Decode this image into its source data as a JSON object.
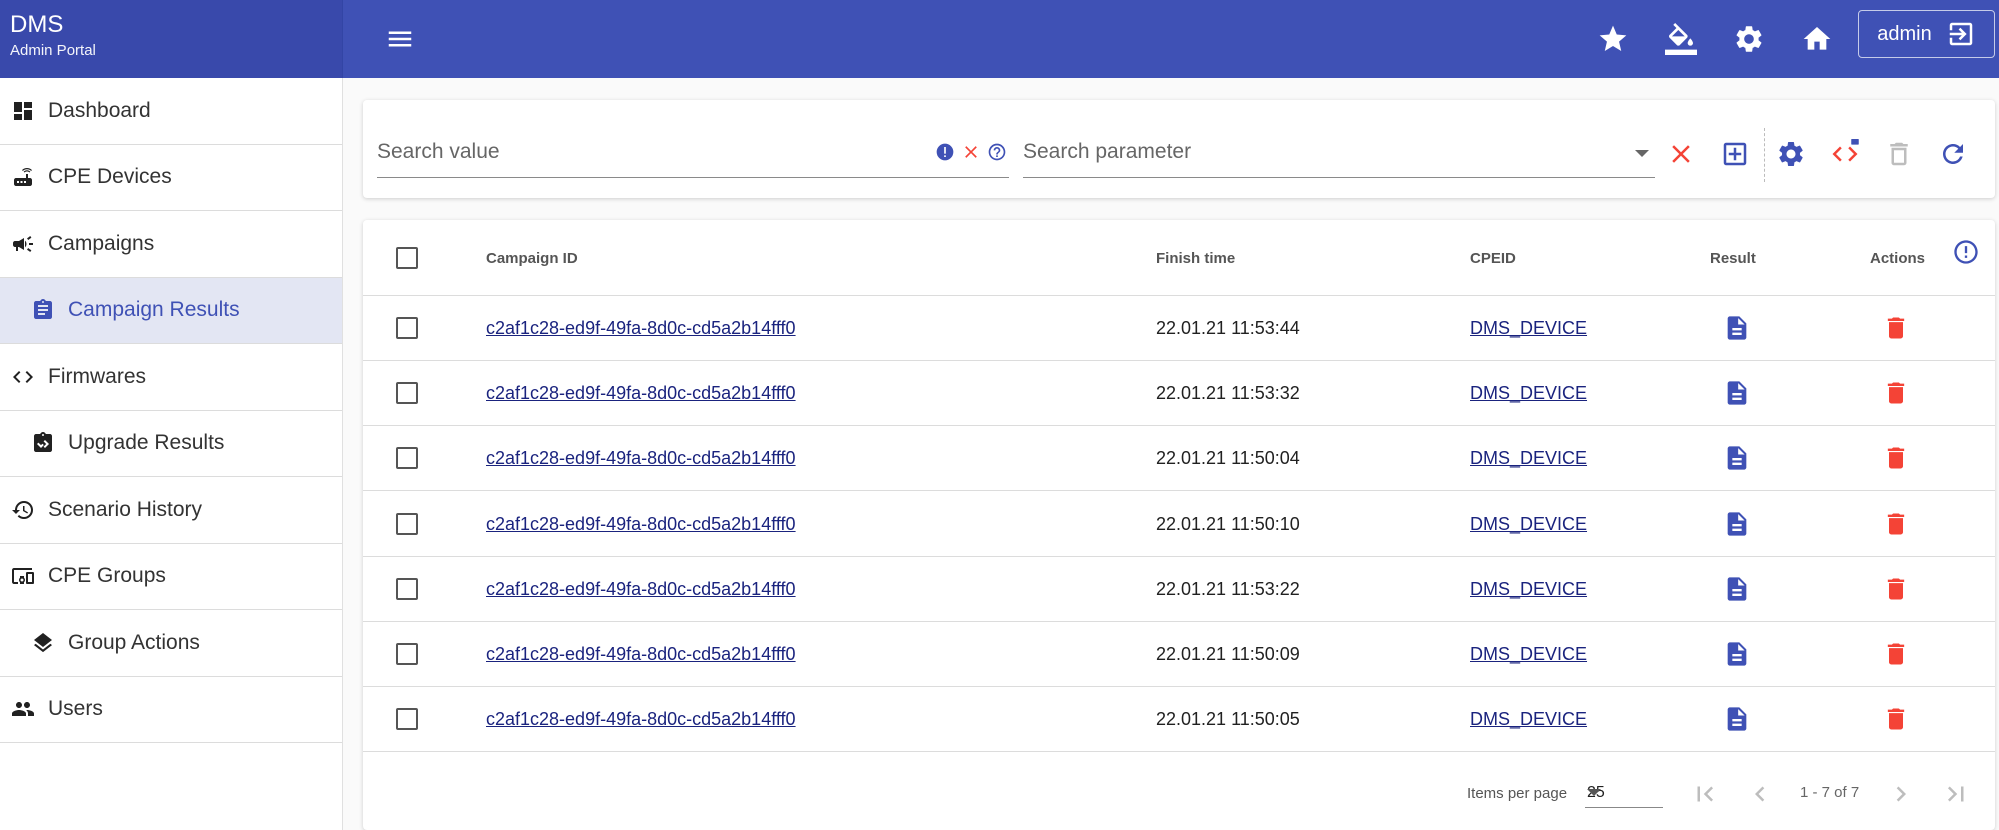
{
  "app": {
    "title": "DMS",
    "subtitle": "Admin Portal"
  },
  "header": {
    "user_label": "admin",
    "icons": [
      "star-icon",
      "format-color-fill-icon",
      "gear-icon",
      "home-icon",
      "exit-to-app-icon",
      "menu-icon"
    ]
  },
  "sidebar": {
    "items": [
      {
        "label": "Dashboard",
        "icon": "dashboard-icon"
      },
      {
        "label": "CPE Devices",
        "icon": "router-icon"
      },
      {
        "label": "Campaigns",
        "icon": "campaign-icon"
      },
      {
        "label": "Campaign Results",
        "icon": "assignment-icon"
      },
      {
        "label": "Firmwares",
        "icon": "code-icon"
      },
      {
        "label": "Upgrade Results",
        "icon": "upgrade-icon"
      },
      {
        "label": "Scenario History",
        "icon": "history-icon"
      },
      {
        "label": "CPE Groups",
        "icon": "devices-icon"
      },
      {
        "label": "Group Actions",
        "icon": "layers-icon"
      },
      {
        "label": "Users",
        "icon": "people-icon"
      }
    ],
    "active": "Campaign Results"
  },
  "search": {
    "value_placeholder": "Search value",
    "value": "",
    "parameter_placeholder": "Search parameter",
    "parameter": ""
  },
  "table": {
    "columns": {
      "campaign_id": "Campaign ID",
      "finish_time": "Finish time",
      "cpeid": "CPEID",
      "result": "Result",
      "actions": "Actions"
    },
    "rows": [
      {
        "campaign_id": "c2af1c28-ed9f-49fa-8d0c-cd5a2b14fff0",
        "finish_time": "22.01.21 11:53:44",
        "cpeid": "DMS_DEVICE"
      },
      {
        "campaign_id": "c2af1c28-ed9f-49fa-8d0c-cd5a2b14fff0",
        "finish_time": "22.01.21 11:53:32",
        "cpeid": "DMS_DEVICE"
      },
      {
        "campaign_id": "c2af1c28-ed9f-49fa-8d0c-cd5a2b14fff0",
        "finish_time": "22.01.21 11:50:04",
        "cpeid": "DMS_DEVICE"
      },
      {
        "campaign_id": "c2af1c28-ed9f-49fa-8d0c-cd5a2b14fff0",
        "finish_time": "22.01.21 11:50:10",
        "cpeid": "DMS_DEVICE"
      },
      {
        "campaign_id": "c2af1c28-ed9f-49fa-8d0c-cd5a2b14fff0",
        "finish_time": "22.01.21 11:53:22",
        "cpeid": "DMS_DEVICE"
      },
      {
        "campaign_id": "c2af1c28-ed9f-49fa-8d0c-cd5a2b14fff0",
        "finish_time": "22.01.21 11:50:09",
        "cpeid": "DMS_DEVICE"
      },
      {
        "campaign_id": "c2af1c28-ed9f-49fa-8d0c-cd5a2b14fff0",
        "finish_time": "22.01.21 11:50:05",
        "cpeid": "DMS_DEVICE"
      }
    ]
  },
  "paginator": {
    "items_per_page_label": "Items per page",
    "page_size": "25",
    "range_label": "1 - 7 of 7"
  },
  "colors": {
    "primary": "#3f51b5",
    "primary_dark": "#3949ab",
    "accent_red": "#f44336",
    "link": "#1a237e",
    "active_bg": "#e3e6f3"
  }
}
